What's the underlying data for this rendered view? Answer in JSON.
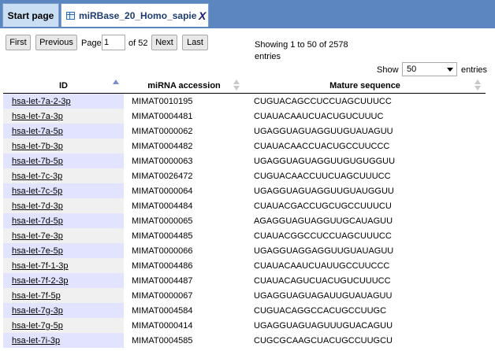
{
  "tabs": [
    {
      "label": "Start page"
    },
    {
      "label": "miRBase_20_Homo_sapie...",
      "close": "X",
      "icon": "table-icon"
    }
  ],
  "pager": {
    "first": "First",
    "previous": "Previous",
    "page_label": "Page",
    "page_value": "1",
    "of_label": "of 52",
    "next": "Next",
    "last": "Last",
    "showing_line1": "Showing 1 to 50 of 2578",
    "showing_line2": "entries",
    "show_label": "Show",
    "show_value": "50",
    "entries_label": "entries"
  },
  "table": {
    "columns": [
      "ID",
      "miRNA accession",
      "Mature sequence"
    ],
    "rows": [
      [
        "hsa-let-7a-2-3p",
        "MIMAT0010195",
        "CUGUACAGCCUCCUAGCUUUCC"
      ],
      [
        "hsa-let-7a-3p",
        "MIMAT0004481",
        "CUAUACAAUCUACUGUCUUUC"
      ],
      [
        "hsa-let-7a-5p",
        "MIMAT0000062",
        "UGAGGUAGUAGGUUGUAUAGUU"
      ],
      [
        "hsa-let-7b-3p",
        "MIMAT0004482",
        "CUAUACAACCUACUGCCUUCCC"
      ],
      [
        "hsa-let-7b-5p",
        "MIMAT0000063",
        "UGAGGUAGUAGGUUGUGUGGUU"
      ],
      [
        "hsa-let-7c-3p",
        "MIMAT0026472",
        "CUGUACAACCUUCUAGCUUUCC"
      ],
      [
        "hsa-let-7c-5p",
        "MIMAT0000064",
        "UGAGGUAGUAGGUUGUAUGGUU"
      ],
      [
        "hsa-let-7d-3p",
        "MIMAT0004484",
        "CUAUACGACCUGCUGCCUUUCU"
      ],
      [
        "hsa-let-7d-5p",
        "MIMAT0000065",
        "AGAGGUAGUAGGUUGCAUAGUU"
      ],
      [
        "hsa-let-7e-3p",
        "MIMAT0004485",
        "CUAUACGGCCUCCUAGCUUUCC"
      ],
      [
        "hsa-let-7e-5p",
        "MIMAT0000066",
        "UGAGGUAGGAGGUUGUAUAGUU"
      ],
      [
        "hsa-let-7f-1-3p",
        "MIMAT0004486",
        "CUAUACAAUCUAUUGCCUUCCC"
      ],
      [
        "hsa-let-7f-2-3p",
        "MIMAT0004487",
        "CUAUACAGUCUACUGUCUUUCC"
      ],
      [
        "hsa-let-7f-5p",
        "MIMAT0000067",
        "UGAGGUAGUAGAUUGUAUAGUU"
      ],
      [
        "hsa-let-7g-3p",
        "MIMAT0004584",
        "CUGUACAGGCCACUGCCUUGC"
      ],
      [
        "hsa-let-7g-5p",
        "MIMAT0000414",
        "UGAGGUAGUAGUUUGUACAGUU"
      ],
      [
        "hsa-let-7i-3p",
        "MIMAT0004585",
        "CUGCGCAAGCUACUGCCUUGCU"
      ]
    ]
  },
  "colors": {
    "tabbar": "#5b86bf",
    "row_highlight": "#e2e4ff",
    "row_alt": "#f0f0f0",
    "tab_text": "#1f3d72"
  }
}
